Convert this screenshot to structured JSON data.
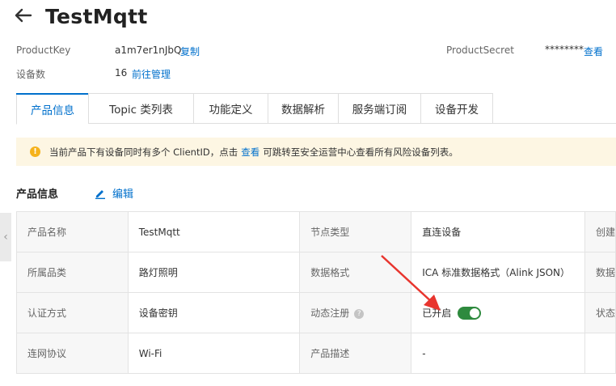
{
  "header": {
    "title": "TestMqtt",
    "back_icon": "arrow-left-icon"
  },
  "meta": {
    "product_key_label": "ProductKey",
    "product_key_value": "a1m7er1nJbQ",
    "copy_label": "复制",
    "device_count_label": "设备数",
    "device_count_value": "16",
    "manage_label": "前往管理",
    "product_secret_label": "ProductSecret",
    "product_secret_value": "********",
    "view_label": "查看"
  },
  "tabs": [
    {
      "label": "产品信息",
      "active": true
    },
    {
      "label": "Topic 类列表",
      "active": false
    },
    {
      "label": "功能定义",
      "active": false
    },
    {
      "label": "数据解析",
      "active": false
    },
    {
      "label": "服务端订阅",
      "active": false
    },
    {
      "label": "设备开发",
      "active": false
    }
  ],
  "notice": {
    "icon": "warning-icon",
    "text_before": "当前产品下有设备同时有多个 ClientID，点击",
    "link": "查看",
    "text_after": "可跳转至安全运营中心查看所有风险设备列表。"
  },
  "section": {
    "title": "产品信息",
    "edit_label": "编辑",
    "edit_icon": "edit-icon"
  },
  "table": {
    "rows": [
      [
        "产品名称",
        "TestMqtt",
        "节点类型",
        "直连设备",
        "创建"
      ],
      [
        "所属品类",
        "路灯照明",
        "数据格式",
        "ICA 标准数据格式（Alink JSON）",
        "数据"
      ],
      [
        "认证方式",
        "设备密钥",
        "动态注册",
        "已开启",
        "状态"
      ],
      [
        "连网协议",
        "Wi-Fi",
        "产品描述",
        "-",
        ""
      ]
    ],
    "dynamic_register_enabled": true
  },
  "colors": {
    "accent": "#0070cc",
    "switch_on": "#2e8a3e",
    "arrow": "#e8352e",
    "notice_bg": "#fdf6e3"
  }
}
